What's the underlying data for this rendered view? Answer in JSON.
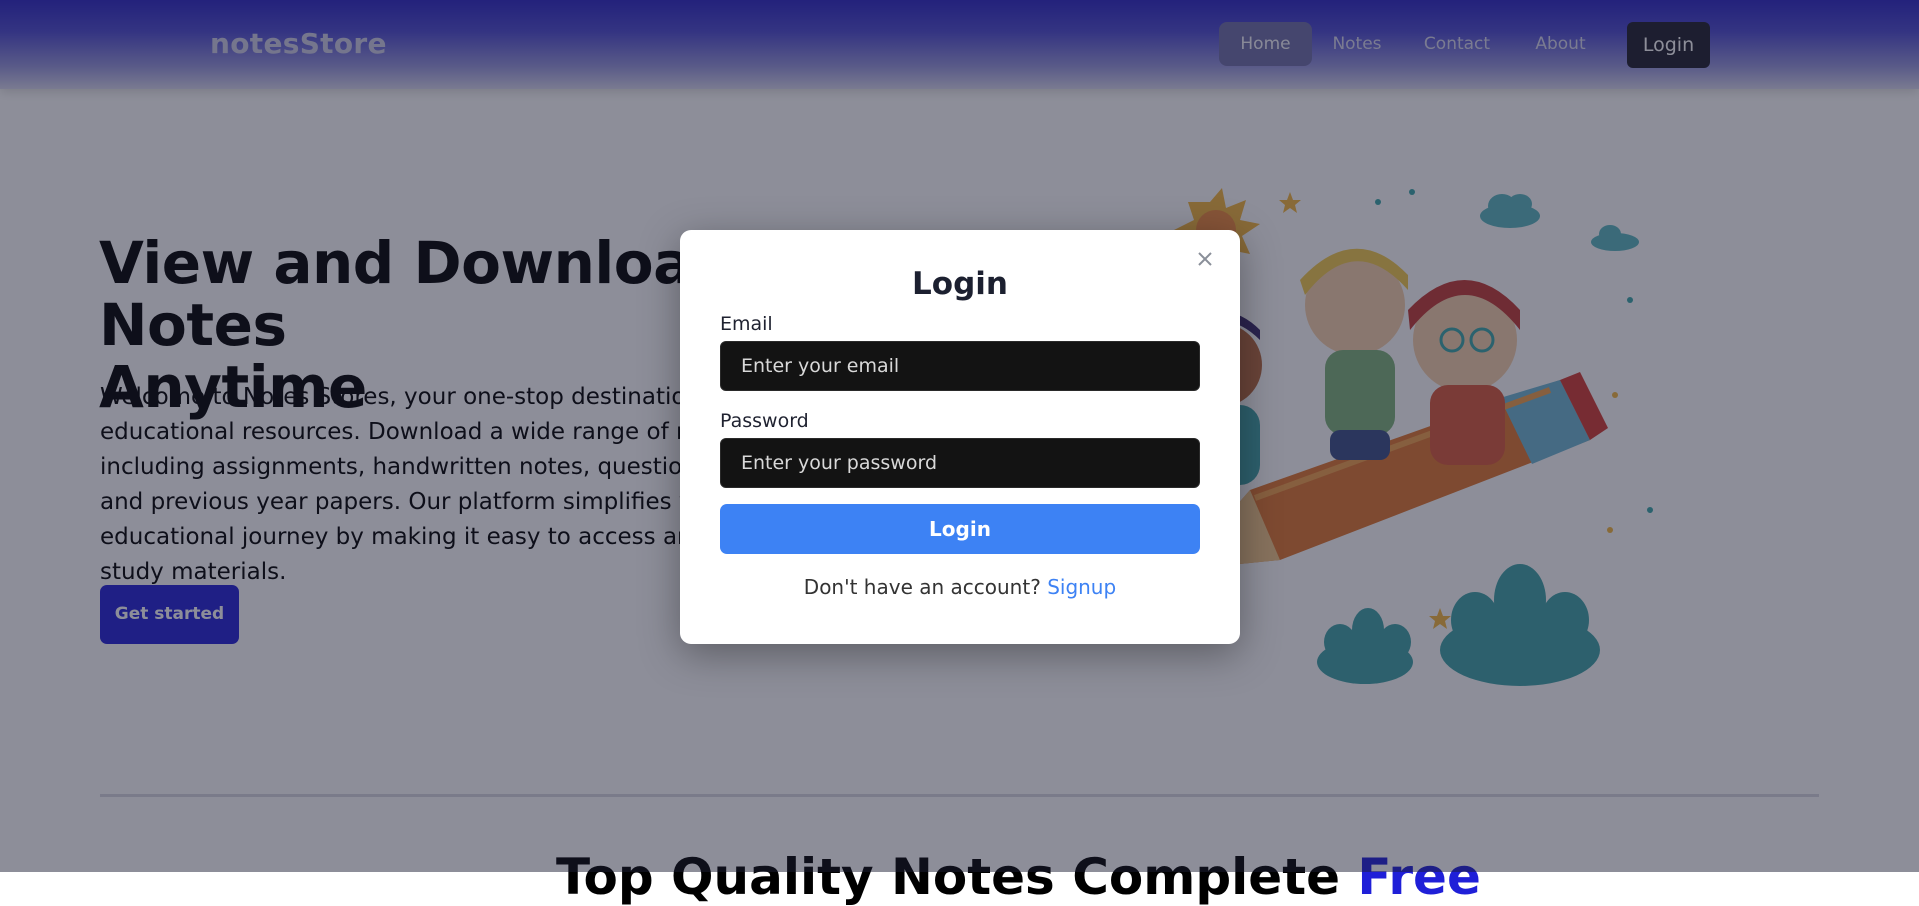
{
  "nav": {
    "brand": "notesStore",
    "links": [
      "Home",
      "Notes",
      "Contact",
      "About"
    ],
    "login_label": "Login"
  },
  "hero": {
    "title_line1": "View and Download Notes",
    "title_line2": "Anytime",
    "description": "Welcome to Notes Stores, your one-stop destination for educational resources. Download a wide range of notes, including assignments, handwritten notes, question papers, and previous year papers. Our platform simplifies your educational journey by making it easy to access and organize study materials.",
    "cta_label": "Get started"
  },
  "section": {
    "title": "Top Quality Notes Complete ",
    "title_accent": "Free"
  },
  "modal": {
    "title": "Login",
    "email_label": "Email",
    "email_placeholder": "Enter your email",
    "password_label": "Password",
    "password_placeholder": "Enter your password",
    "submit_label": "Login",
    "signup_prompt": "Don't have an account?",
    "signup_link": "Signup",
    "close_icon": "close-icon"
  },
  "colors": {
    "nav_gradient_top": "#2b26c4",
    "accent_blue": "#3d82f4",
    "hero_button": "#2220d6",
    "input_bg": "#131313"
  }
}
